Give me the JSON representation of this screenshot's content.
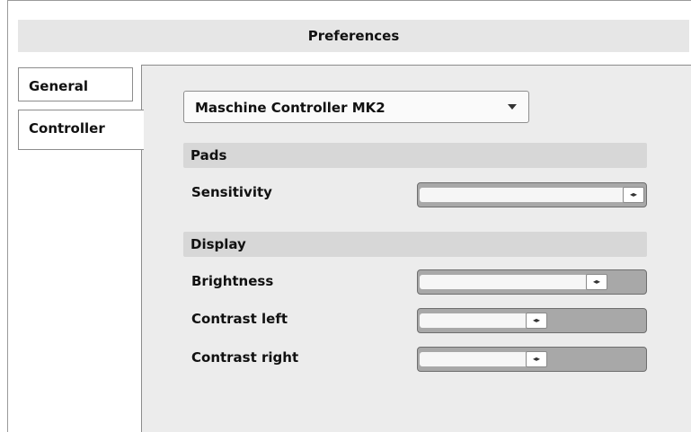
{
  "window": {
    "title": "Preferences"
  },
  "tabs": [
    {
      "label": "General",
      "selected": false
    },
    {
      "label": "Controller",
      "selected": true
    }
  ],
  "controller_select": {
    "value": "Maschine Controller MK2",
    "icon": "chevron-down-icon"
  },
  "sections": {
    "pads": {
      "header": "Pads",
      "sensitivity": {
        "label": "Sensitivity",
        "value": 1.0
      }
    },
    "display": {
      "header": "Display",
      "brightness": {
        "label": "Brightness",
        "value": 0.82
      },
      "contrast_left": {
        "label": "Contrast left",
        "value": 0.52
      },
      "contrast_right": {
        "label": "Contrast right",
        "value": 0.52
      }
    }
  },
  "slider_handle_glyph": "◂▸"
}
